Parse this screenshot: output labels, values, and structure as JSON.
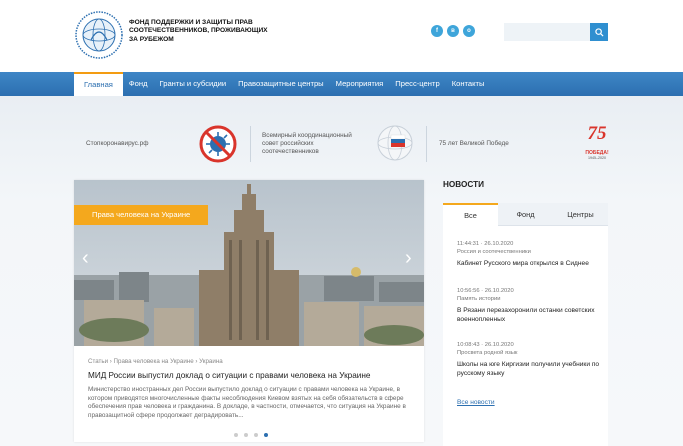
{
  "header": {
    "org_name": "Фонд поддержки и защиты прав соотечественников, проживающих за рубежом",
    "socials": [
      "f",
      "в",
      "о"
    ],
    "search_placeholder": ""
  },
  "nav": [
    "Главная",
    "Фонд",
    "Гранты и субсидии",
    "Правозащитные центры",
    "Мероприятия",
    "Пресс-центр",
    "Контакты"
  ],
  "partners": {
    "covid": "Стопкоронавирус.рф",
    "council": "Всемирный координационный совет российских соотечественников",
    "victory": "75 лет Великой Победе",
    "victory_logo_top": "75",
    "victory_logo_word": "ПОБЕДА!",
    "victory_logo_years": "1945–2020"
  },
  "slide": {
    "tag": "Права человека на Украине",
    "meta": "Статьи › Права человека на Украине › Украина",
    "title": "МИД России выпустил доклад о ситуации с правами человека на Украине",
    "text": "Министерство иностранных дел России выпустило доклад о ситуации с правами человека на Украине, в котором приводятся многочисленные факты несоблюдения Киевом взятых на себя обязательств в сфере обеспечения прав человека и гражданина. В докладе, в частности, отмечается, что ситуация на Украине в правозащитной сфере продолжает деградировать..."
  },
  "news": {
    "heading": "НОВОСТИ",
    "tabs": [
      "Все",
      "Фонд",
      "Центры"
    ],
    "items": [
      {
        "date": "11:44:31 · 26.10.2020",
        "category": "Россия и соотечественники",
        "title": "Кабинет Русского мира открылся в Сиднее"
      },
      {
        "date": "10:56:56 · 26.10.2020",
        "category": "Память истории",
        "title": "В Рязани перезахоронили останки советских военнопленных"
      },
      {
        "date": "10:08:43 · 26.10.2020",
        "category": "Просвета родной язык",
        "title": "Школы на юге Киргизии получили учебники по русскому языку"
      }
    ],
    "all_link": "Все новости"
  }
}
